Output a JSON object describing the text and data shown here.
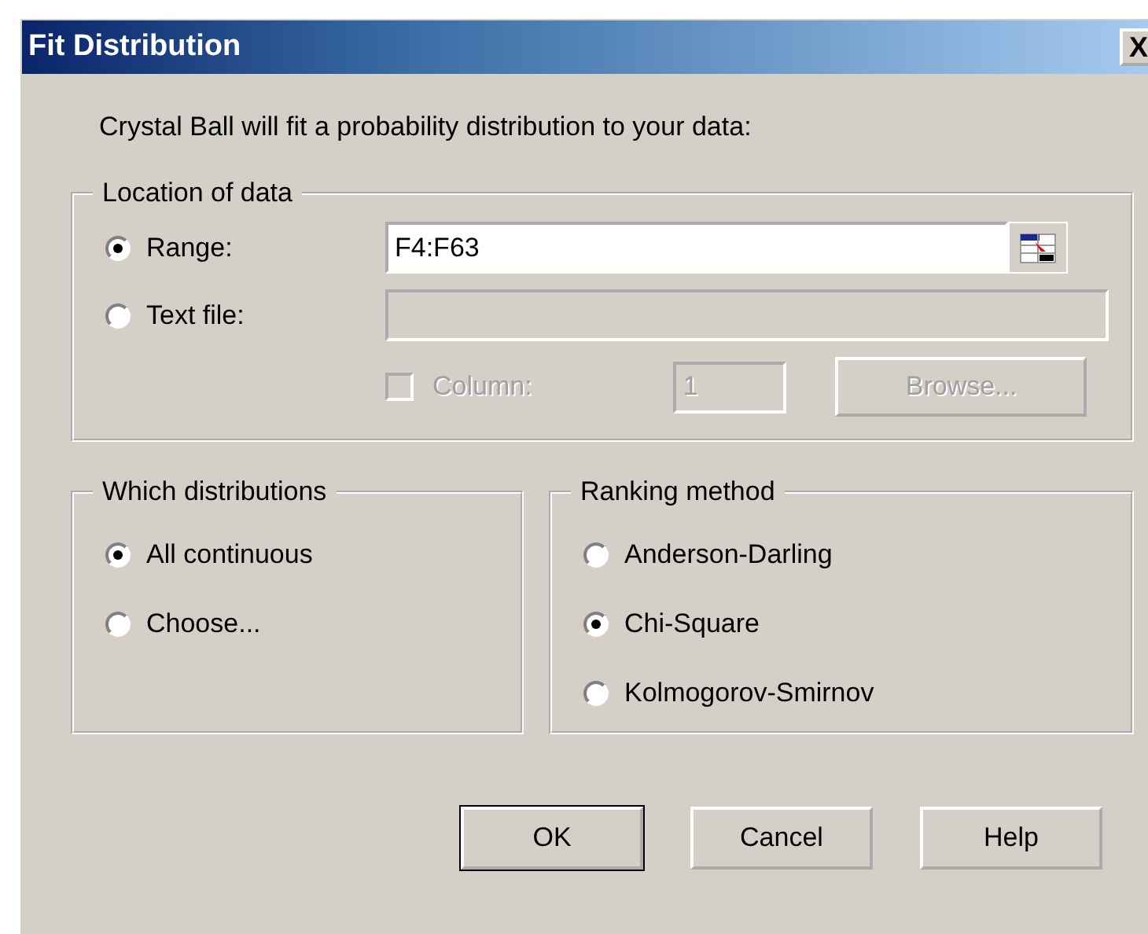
{
  "window": {
    "title": "Fit Distribution",
    "close": "X"
  },
  "intro": "Crystal Ball will fit a probability distribution to your data:",
  "location": {
    "title": "Location of data",
    "options": [
      {
        "label": "Range:",
        "selected": true
      },
      {
        "label": "Text file:",
        "selected": false
      }
    ],
    "range_value": "F4:F63",
    "column": {
      "label": "Column:",
      "checked": false,
      "disabled": true,
      "value": "1"
    },
    "browse": {
      "label": "Browse...",
      "disabled": true
    }
  },
  "distributions": {
    "title": "Which distributions",
    "options": [
      {
        "label": "All continuous",
        "selected": true
      },
      {
        "label": "Choose...",
        "selected": false
      }
    ]
  },
  "ranking": {
    "title": "Ranking method",
    "options": [
      {
        "label": "Anderson-Darling",
        "selected": false
      },
      {
        "label": "Chi-Square",
        "selected": true
      },
      {
        "label": "Kolmogorov-Smirnov",
        "selected": false
      }
    ]
  },
  "buttons": [
    {
      "label": "OK",
      "default": true
    },
    {
      "label": "Cancel",
      "default": false
    },
    {
      "label": "Help",
      "default": false
    }
  ]
}
